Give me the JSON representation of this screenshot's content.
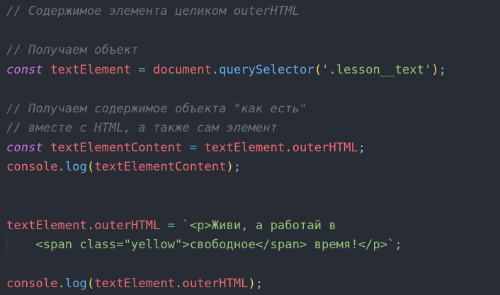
{
  "colors": {
    "background": "#282c34",
    "comment": "#6b7380",
    "keyword": "#c678dd",
    "variable": "#ef6b73",
    "operator": "#56b6c2",
    "function": "#61afef",
    "paren": "#f0d26b",
    "string": "#98c379",
    "plain": "#c8ccd4"
  },
  "code": {
    "l1_comment": "// Содержимое элемента целиком outerHTML",
    "l3_comment": "// Получаем объект",
    "l4_const": "const",
    "l4_var": "textElement",
    "l4_eq": "=",
    "l4_obj": "document",
    "l4_dot": ".",
    "l4_method": "querySelector",
    "l4_open": "(",
    "l4_str": "'.lesson__text'",
    "l4_close": ")",
    "l4_semi": ";",
    "l6_comment": "// Получаем содержимое объекта \"как есть\"",
    "l7_comment": "// вместе с HTML, а также сам элемент",
    "l8_const": "const",
    "l8_var": "textElementContent",
    "l8_eq": "=",
    "l8_obj": "textElement",
    "l8_dot": ".",
    "l8_prop": "outerHTML",
    "l8_semi": ";",
    "l9_obj": "console",
    "l9_dot": ".",
    "l9_method": "log",
    "l9_open": "(",
    "l9_arg": "textElementContent",
    "l9_close": ")",
    "l9_semi": ";",
    "l12_obj": "textElement",
    "l12_dot": ".",
    "l12_prop": "outerHTML",
    "l12_eq": "=",
    "l12_tpl": "`<p>Живи, а работай в",
    "l13_tpl": "<span class=\"yellow\">свободное</span> время!</p>`",
    "l13_semi": ";",
    "l15_obj": "console",
    "l15_dot": ".",
    "l15_method": "log",
    "l15_open": "(",
    "l15_arg_obj": "textElement",
    "l15_arg_dot": ".",
    "l15_arg_prop": "outerHTML",
    "l15_close": ")",
    "l15_semi": ";"
  }
}
